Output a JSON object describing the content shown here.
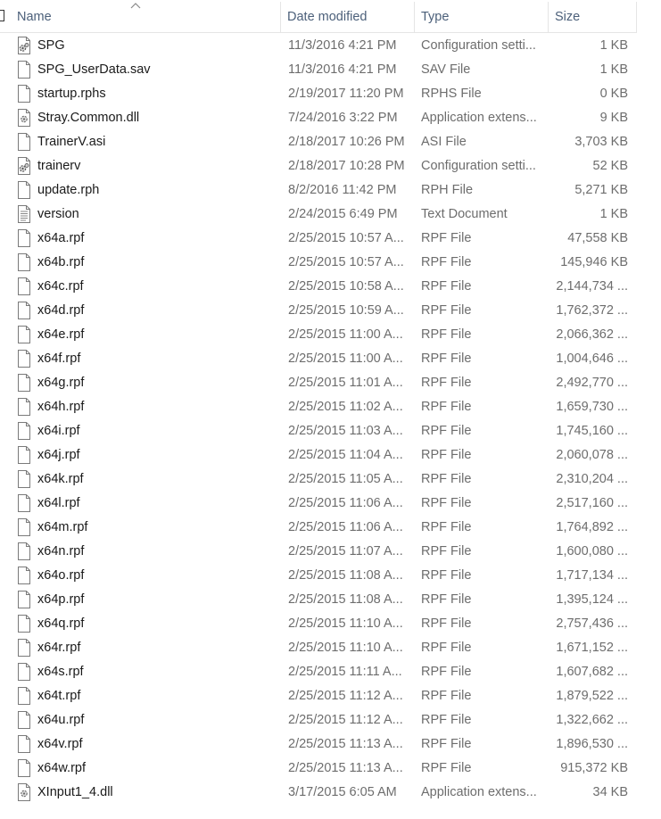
{
  "header": {
    "columns": [
      {
        "key": "name",
        "label": "Name"
      },
      {
        "key": "date",
        "label": "Date modified"
      },
      {
        "key": "type",
        "label": "Type"
      },
      {
        "key": "size",
        "label": "Size"
      }
    ],
    "sort_indicator": "sort-ascending-icon",
    "header_text_color": "#4c607a"
  },
  "files": [
    {
      "name": "SPG",
      "date": "11/3/2016 4:21 PM",
      "type": "Configuration setti...",
      "size": "1 KB",
      "icon": "config-file-icon"
    },
    {
      "name": "SPG_UserData.sav",
      "date": "11/3/2016 4:21 PM",
      "type": "SAV File",
      "size": "1 KB",
      "icon": "file-icon"
    },
    {
      "name": "startup.rphs",
      "date": "2/19/2017 11:20 PM",
      "type": "RPHS File",
      "size": "0 KB",
      "icon": "file-icon"
    },
    {
      "name": "Stray.Common.dll",
      "date": "7/24/2016 3:22 PM",
      "type": "Application extens...",
      "size": "9 KB",
      "icon": "dll-file-icon"
    },
    {
      "name": "TrainerV.asi",
      "date": "2/18/2017 10:26 PM",
      "type": "ASI File",
      "size": "3,703 KB",
      "icon": "file-icon"
    },
    {
      "name": "trainerv",
      "date": "2/18/2017 10:28 PM",
      "type": "Configuration setti...",
      "size": "52 KB",
      "icon": "config-file-icon"
    },
    {
      "name": "update.rph",
      "date": "8/2/2016 11:42 PM",
      "type": "RPH File",
      "size": "5,271 KB",
      "icon": "file-icon"
    },
    {
      "name": "version",
      "date": "2/24/2015 6:49 PM",
      "type": "Text Document",
      "size": "1 KB",
      "icon": "text-file-icon"
    },
    {
      "name": "x64a.rpf",
      "date": "2/25/2015 10:57 A...",
      "type": "RPF File",
      "size": "47,558 KB",
      "icon": "file-icon"
    },
    {
      "name": "x64b.rpf",
      "date": "2/25/2015 10:57 A...",
      "type": "RPF File",
      "size": "145,946 KB",
      "icon": "file-icon"
    },
    {
      "name": "x64c.rpf",
      "date": "2/25/2015 10:58 A...",
      "type": "RPF File",
      "size": "2,144,734 ...",
      "icon": "file-icon"
    },
    {
      "name": "x64d.rpf",
      "date": "2/25/2015 10:59 A...",
      "type": "RPF File",
      "size": "1,762,372 ...",
      "icon": "file-icon"
    },
    {
      "name": "x64e.rpf",
      "date": "2/25/2015 11:00 A...",
      "type": "RPF File",
      "size": "2,066,362 ...",
      "icon": "file-icon"
    },
    {
      "name": "x64f.rpf",
      "date": "2/25/2015 11:00 A...",
      "type": "RPF File",
      "size": "1,004,646 ...",
      "icon": "file-icon"
    },
    {
      "name": "x64g.rpf",
      "date": "2/25/2015 11:01 A...",
      "type": "RPF File",
      "size": "2,492,770 ...",
      "icon": "file-icon"
    },
    {
      "name": "x64h.rpf",
      "date": "2/25/2015 11:02 A...",
      "type": "RPF File",
      "size": "1,659,730 ...",
      "icon": "file-icon"
    },
    {
      "name": "x64i.rpf",
      "date": "2/25/2015 11:03 A...",
      "type": "RPF File",
      "size": "1,745,160 ...",
      "icon": "file-icon"
    },
    {
      "name": "x64j.rpf",
      "date": "2/25/2015 11:04 A...",
      "type": "RPF File",
      "size": "2,060,078 ...",
      "icon": "file-icon"
    },
    {
      "name": "x64k.rpf",
      "date": "2/25/2015 11:05 A...",
      "type": "RPF File",
      "size": "2,310,204 ...",
      "icon": "file-icon"
    },
    {
      "name": "x64l.rpf",
      "date": "2/25/2015 11:06 A...",
      "type": "RPF File",
      "size": "2,517,160 ...",
      "icon": "file-icon"
    },
    {
      "name": "x64m.rpf",
      "date": "2/25/2015 11:06 A...",
      "type": "RPF File",
      "size": "1,764,892 ...",
      "icon": "file-icon"
    },
    {
      "name": "x64n.rpf",
      "date": "2/25/2015 11:07 A...",
      "type": "RPF File",
      "size": "1,600,080 ...",
      "icon": "file-icon"
    },
    {
      "name": "x64o.rpf",
      "date": "2/25/2015 11:08 A...",
      "type": "RPF File",
      "size": "1,717,134 ...",
      "icon": "file-icon"
    },
    {
      "name": "x64p.rpf",
      "date": "2/25/2015 11:08 A...",
      "type": "RPF File",
      "size": "1,395,124 ...",
      "icon": "file-icon"
    },
    {
      "name": "x64q.rpf",
      "date": "2/25/2015 11:10 A...",
      "type": "RPF File",
      "size": "2,757,436 ...",
      "icon": "file-icon"
    },
    {
      "name": "x64r.rpf",
      "date": "2/25/2015 11:10 A...",
      "type": "RPF File",
      "size": "1,671,152 ...",
      "icon": "file-icon"
    },
    {
      "name": "x64s.rpf",
      "date": "2/25/2015 11:11 A...",
      "type": "RPF File",
      "size": "1,607,682 ...",
      "icon": "file-icon"
    },
    {
      "name": "x64t.rpf",
      "date": "2/25/2015 11:12 A...",
      "type": "RPF File",
      "size": "1,879,522 ...",
      "icon": "file-icon"
    },
    {
      "name": "x64u.rpf",
      "date": "2/25/2015 11:12 A...",
      "type": "RPF File",
      "size": "1,322,662 ...",
      "icon": "file-icon"
    },
    {
      "name": "x64v.rpf",
      "date": "2/25/2015 11:13 A...",
      "type": "RPF File",
      "size": "1,896,530 ...",
      "icon": "file-icon"
    },
    {
      "name": "x64w.rpf",
      "date": "2/25/2015 11:13 A...",
      "type": "RPF File",
      "size": "915,372 KB",
      "icon": "file-icon"
    },
    {
      "name": "XInput1_4.dll",
      "date": "3/17/2015 6:05 AM",
      "type": "Application extens...",
      "size": "34 KB",
      "icon": "dll-file-icon"
    }
  ]
}
